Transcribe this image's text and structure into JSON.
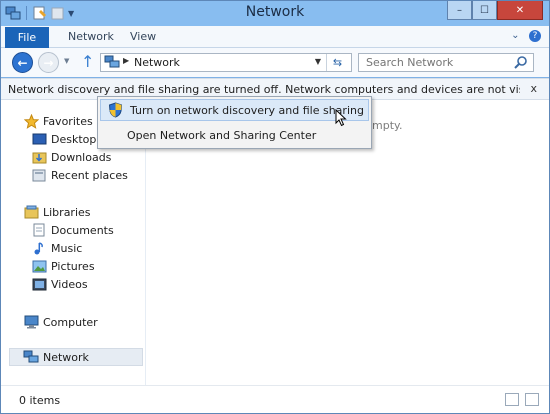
{
  "window": {
    "title": "Network",
    "controls": {
      "minimize": "–",
      "maximize": "☐",
      "close": "✕"
    }
  },
  "ribbon": {
    "file_tab": "File",
    "tabs": [
      "Network",
      "View"
    ]
  },
  "nav": {
    "address_text": "Network",
    "search_placeholder": "Search Network"
  },
  "infobar": {
    "message": "Network discovery and file sharing are turned off. Network computers and devices are not visible. Click to c...",
    "close": "x"
  },
  "sidebar": {
    "favorites": {
      "label": "Favorites",
      "items": [
        "Desktop",
        "Downloads",
        "Recent places"
      ]
    },
    "libraries": {
      "label": "Libraries",
      "items": [
        "Documents",
        "Music",
        "Pictures",
        "Videos"
      ]
    },
    "computer": "Computer",
    "network": "Network"
  },
  "main": {
    "empty_text": "mpty."
  },
  "status": {
    "count": "0 items"
  },
  "context_menu": {
    "items": [
      "Turn on network discovery and file sharing",
      "Open Network and Sharing Center"
    ]
  },
  "colors": {
    "file_tab": "#1b64b8",
    "title_bar": "#88bdf0",
    "close_button": "#c7463c",
    "menu_highlight": "#dbe9f8"
  },
  "icons": {
    "network": "network-icon",
    "star": "favorites-star-icon",
    "folder": "folder-icon",
    "shield": "uac-shield-icon"
  }
}
